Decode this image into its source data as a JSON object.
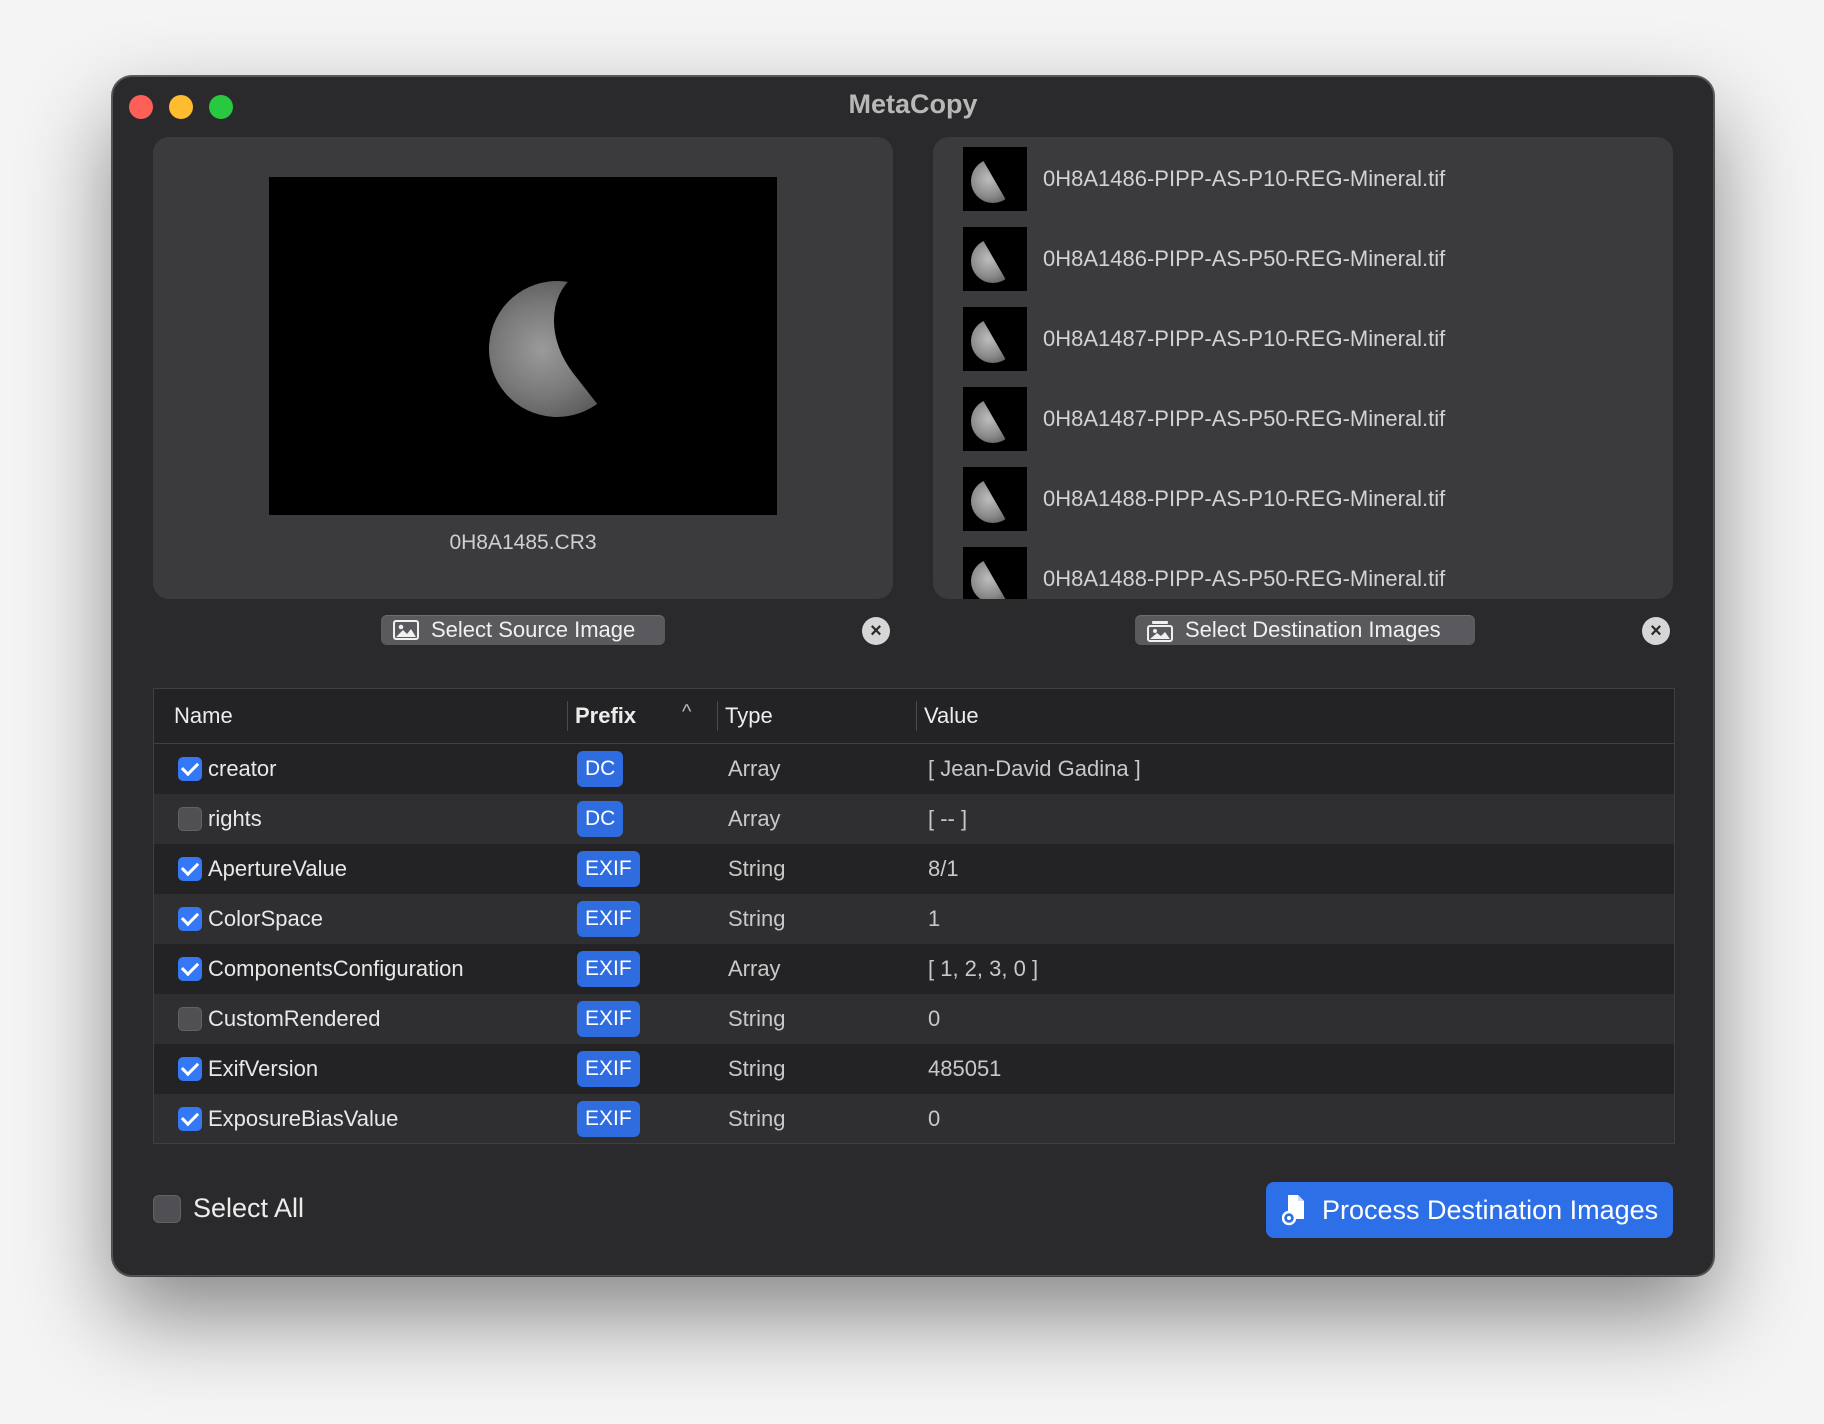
{
  "window": {
    "title": "MetaCopy"
  },
  "source": {
    "filename": "0H8A1485.CR3",
    "select_label": "Select Source Image",
    "clear_glyph": "×"
  },
  "destination": {
    "files": [
      "0H8A1486-PIPP-AS-P10-REG-Mineral.tif",
      "0H8A1486-PIPP-AS-P50-REG-Mineral.tif",
      "0H8A1487-PIPP-AS-P10-REG-Mineral.tif",
      "0H8A1487-PIPP-AS-P50-REG-Mineral.tif",
      "0H8A1488-PIPP-AS-P10-REG-Mineral.tif",
      "0H8A1488-PIPP-AS-P50-REG-Mineral.tif"
    ],
    "select_label": "Select Destination Images",
    "clear_glyph": "×"
  },
  "table": {
    "headers": {
      "name": "Name",
      "prefix": "Prefix",
      "type": "Type",
      "value": "Value",
      "sort_glyph": "^"
    },
    "rows": [
      {
        "checked": true,
        "name": "creator",
        "prefix": "DC",
        "type": "Array",
        "value": "[ Jean-David Gadina ]"
      },
      {
        "checked": false,
        "name": "rights",
        "prefix": "DC",
        "type": "Array",
        "value": "[ -- ]"
      },
      {
        "checked": true,
        "name": "ApertureValue",
        "prefix": "EXIF",
        "type": "String",
        "value": "8/1"
      },
      {
        "checked": true,
        "name": "ColorSpace",
        "prefix": "EXIF",
        "type": "String",
        "value": "1"
      },
      {
        "checked": true,
        "name": "ComponentsConfiguration",
        "prefix": "EXIF",
        "type": "Array",
        "value": "[ 1, 2, 3, 0 ]"
      },
      {
        "checked": false,
        "name": "CustomRendered",
        "prefix": "EXIF",
        "type": "String",
        "value": "0"
      },
      {
        "checked": true,
        "name": "ExifVersion",
        "prefix": "EXIF",
        "type": "String",
        "value": "485051"
      },
      {
        "checked": true,
        "name": "ExposureBiasValue",
        "prefix": "EXIF",
        "type": "String",
        "value": "0"
      }
    ]
  },
  "footer": {
    "select_all_label": "Select All",
    "select_all_checked": false,
    "process_label": "Process Destination Images"
  },
  "colors": {
    "accent": "#3478f6",
    "badge": "#2f6ce0",
    "window_bg": "#2a2a2c"
  },
  "icons": {
    "source_button": "photo-icon",
    "dest_button": "photo-stack-icon",
    "process_button": "doc-gear-icon"
  }
}
